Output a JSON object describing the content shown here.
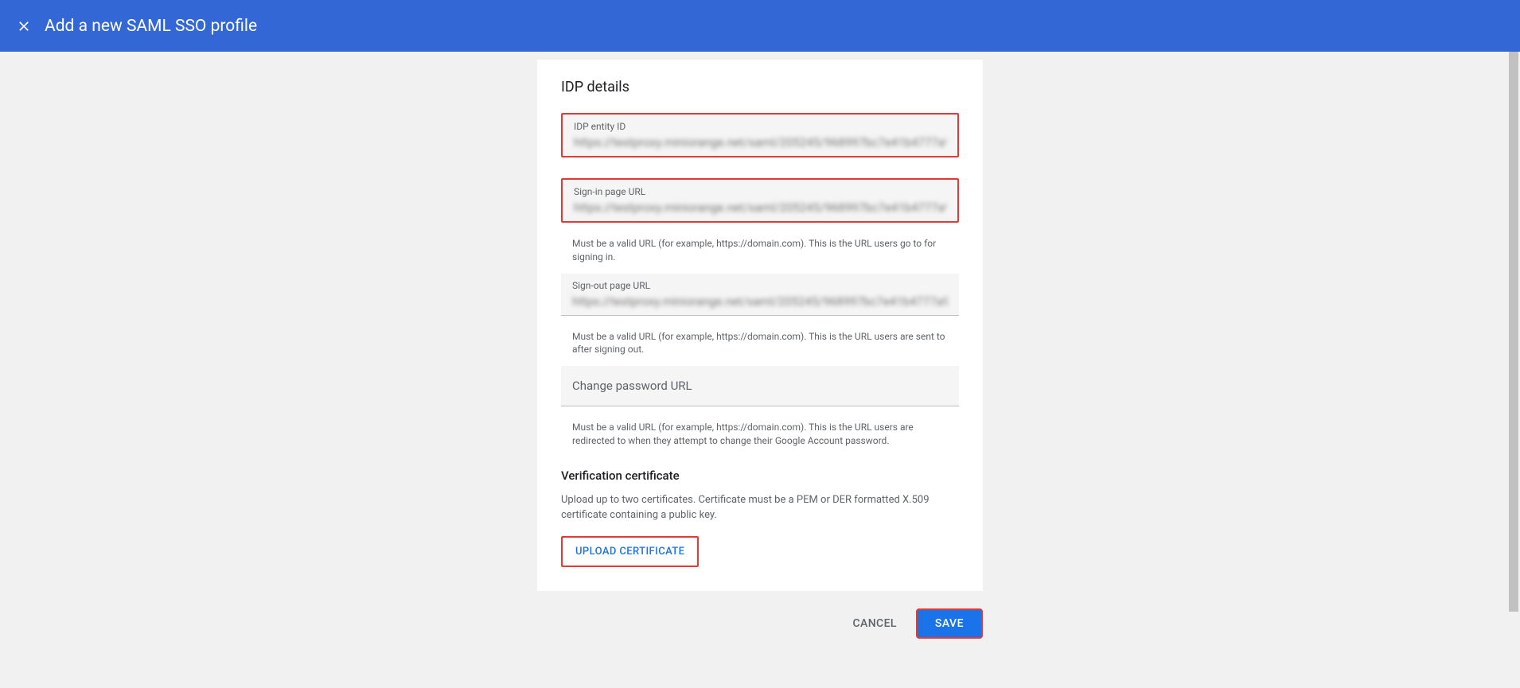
{
  "header": {
    "title": "Add a new SAML SSO profile"
  },
  "section": {
    "title": "IDP details"
  },
  "fields": {
    "idp_entity": {
      "label": "IDP entity ID",
      "value": "https://testproxy.miniorange.net/saml/205245/968997bc7e41b4777a9"
    },
    "signin": {
      "label": "Sign-in page URL",
      "value": "https://testproxy.miniorange.net/saml/205245/968997bc7e41b4777a9",
      "helper": "Must be a valid URL (for example, https://domain.com). This is the URL users go to for signing in."
    },
    "signout": {
      "label": "Sign-out page URL",
      "value": "https://testproxy.miniorange.net/saml/205245/968997bc7e41b4777a9",
      "helper": "Must be a valid URL (for example, https://domain.com). This is the URL users are sent to after signing out."
    },
    "changepw": {
      "placeholder": "Change password URL",
      "helper": "Must be a valid URL (for example, https://domain.com). This is the URL users are redirected to when they attempt to change their Google Account password."
    }
  },
  "certificate": {
    "title": "Verification certificate",
    "description": "Upload up to two certificates. Certificate must be a PEM or DER formatted X.509 certificate containing a public key.",
    "upload_label": "UPLOAD CERTIFICATE"
  },
  "actions": {
    "cancel": "CANCEL",
    "save": "SAVE"
  }
}
